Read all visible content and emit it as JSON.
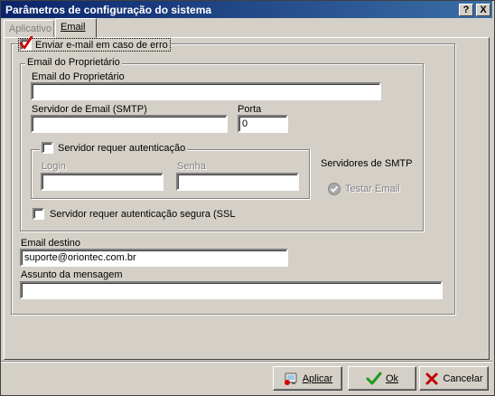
{
  "window": {
    "title": "Parâmetros de configuração do sistema",
    "help_btn": "?",
    "close_btn": "X"
  },
  "tabs": [
    {
      "label": "Aplicativo",
      "active": false
    },
    {
      "label": "Email",
      "active": true
    }
  ],
  "email": {
    "send_on_error_label": "Enviar e-mail em caso de erro",
    "send_on_error_checked": true,
    "owner_group_label": "Email do Proprietário",
    "owner_email_label": "Email do Proprietário",
    "owner_email_value": "",
    "smtp_label": "Servidor de Email (SMTP)",
    "smtp_value": "",
    "port_label": "Porta",
    "port_value": "0",
    "auth_label": "Servidor requer autenticação",
    "login_label": "Login",
    "login_value": "",
    "password_label": "Senha",
    "password_value": "",
    "smtp_servers_label": "Servidores de SMTP",
    "test_email_label": "Testar Email",
    "ssl_label": "Servidor requer autenticação segura (SSL",
    "dest_label": "Email destino",
    "dest_value": "suporte@oriontec.com.br",
    "subject_label": "Assunto da mensagem",
    "subject_value": ""
  },
  "footer": {
    "apply_label": "Aplicar",
    "ok_label": "Ok",
    "cancel_label": "Cancelar"
  },
  "colors": {
    "title_start": "#0a246a",
    "title_end": "#3a6ea5",
    "face": "#d4d0c8",
    "check_red": "#d40000",
    "ok_green": "#1c9a1c",
    "cancel_red": "#c00000"
  }
}
